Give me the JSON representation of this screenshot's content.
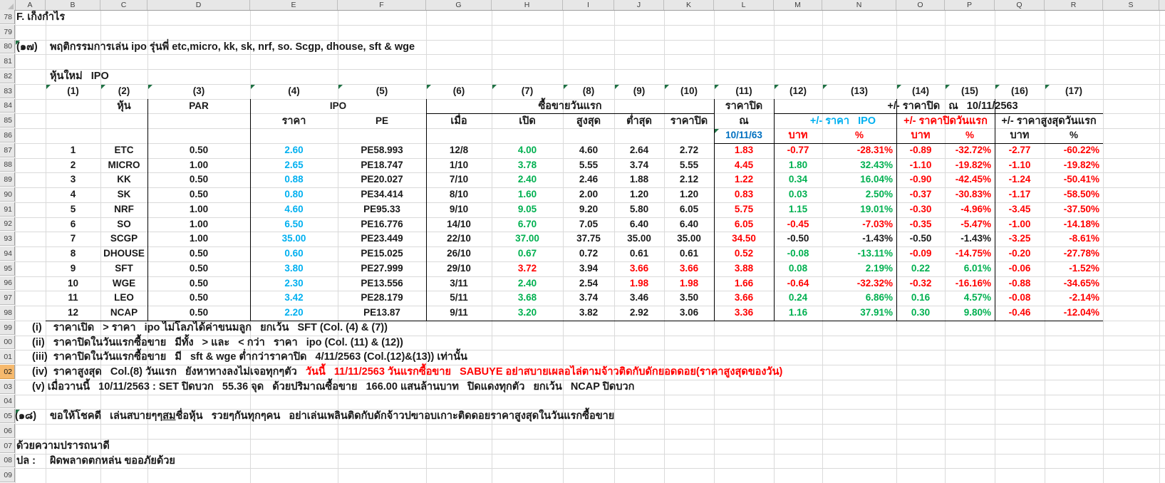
{
  "colors": {
    "black": "#1a1a1a",
    "red": "#FF0000",
    "green": "#00B050",
    "cyan": "#00B0F0",
    "navy": "#0070C0",
    "triangle_green": "#1f7244",
    "rowhead_highlight": "#f6b96d"
  },
  "sheet": {
    "column_letters": [
      "A",
      "B",
      "C",
      "D",
      "E",
      "F",
      "G",
      "H",
      "I",
      "J",
      "K",
      "L",
      "M",
      "N",
      "O",
      "P",
      "Q",
      "R",
      "S"
    ],
    "row_labels": [
      "78",
      "79",
      "80",
      "81",
      "82",
      "83",
      "84",
      "85",
      "86",
      "87",
      "88",
      "89",
      "90",
      "91",
      "92",
      "93",
      "94",
      "95",
      "96",
      "97",
      "98",
      "99",
      "00",
      "01",
      "02",
      "03",
      "04",
      "05",
      "06",
      "07",
      "08",
      "09"
    ],
    "highlighted_row_label": "02"
  },
  "texts": {
    "r78": "F. เก็งกำไร",
    "r80_no": "(๑๗)",
    "r80": "พฤติกรรมการเล่น ipo รุ่นพี่ etc,micro, kk, sk, nrf, so. Scgp, dhouse, sft & wge",
    "r82": "หุ้นใหม่   IPO",
    "r105_no": "(๑๘)",
    "r105_pre": "ขอให้โชคดี   เล่นสบายๆๆ",
    "r105_underline": "สม",
    "r105_post": "ชื่อหุ้น   รวยๆกันทุกๆคน   อย่าเล่นเพลินติดกับดักจ้าวปฃาอบเกาะติดดอยราคาสูงสุดในวันแรกซื้อขาย",
    "r107": "ด้วยความปรารถนาดี",
    "r108_no": "ปล :",
    "r108": "ผิดพลาดตกหล่น ขออภัยด้วย"
  },
  "notes": [
    {
      "black": "(i)    ราคาเปิด   > ราคา   ipo ไม่โลภได้ค่าขนมลูก   ยกเว้น   SFT (Col. (4) & (7))",
      "red": ""
    },
    {
      "black": "(ii)   ราคาปิดในวันแรกซื้อขาย   มีทั้ง   > และ   < กว่า   ราคา   ipo (Col. (11) & (12))",
      "red": ""
    },
    {
      "black": "(iii)  ราคาปิดในวันแรกซื้อขาย   มี   sft & wge ต่ำกว่าราคาปิด   4/11/2563 (Col.(12)&(13)) เท่านั้น",
      "red": ""
    },
    {
      "black": "(iv)  ราคาสูงสุด   Col.(8) วันแรก   ยังหาทางลงไม่เจอทุกๆตัว   ",
      "red": "วันนี้   11/11/2563 วันแรกซื้อขาย   SABUYE อย่าสบายเผลอไล่ตามจ้าวติดกับดักยอดดอย(ราคาสูงสุดของวัน)"
    },
    {
      "black": "(v) เมื่อวานนี้   10/11/2563 : SET ปิดบวก   55.36 จุด   ด้วยปริมาณซื้อขาย   166.00 แสนล้านบาท   ปิดแดงทุกตัว   ยกเว้น   NCAP ปิดบวก",
      "red": ""
    }
  ],
  "table": {
    "col_numbers": [
      "(1)",
      "(2)",
      "(3)",
      "(4)",
      "(5)",
      "(6)",
      "(7)",
      "(8)",
      "(9)",
      "(10)",
      "(11)",
      "(12)",
      "(13)",
      "(14)",
      "(15)",
      "(16)",
      "(17)"
    ],
    "group_headers": {
      "hun": "หุ้น",
      "par": "PAR",
      "ipo": "IPO",
      "first_day": "ซื้อขายวันแรก",
      "close_at": "ราคาปิด",
      "chg_close": "+/- ราคาปิด   ณ   10/11/2563"
    },
    "sub_headers": {
      "price": "ราคา",
      "pe": "PE",
      "when": "เมื่อ",
      "open": "เปิด",
      "high": "สูงสุด",
      "low": "ต่ำสุด",
      "close": "ราคาปิด",
      "at": "ณ",
      "date": "10/11/63",
      "chg_ipo": "+/- ราคา   IPO",
      "chg_day1": "+/- ราคาปิดวันแรก",
      "chg_high1": "+/- ราคาสูงสุดวันแรก",
      "baht": "บาท",
      "pct": "%"
    },
    "rows": [
      {
        "cells": [
          "1",
          "ETC",
          "0.50",
          "2.60",
          "PE58.993",
          "12/8",
          "4.00",
          "4.60",
          "2.64",
          "2.72",
          "1.83",
          "-0.77",
          "-28.31%",
          "-0.89",
          "-32.72%",
          "-2.77",
          "-60.22%"
        ],
        "colors": "kkkbkkgkkkrrrrrrr"
      },
      {
        "cells": [
          "2",
          "MICRO",
          "1.00",
          "2.65",
          "PE18.747",
          "1/10",
          "3.78",
          "5.55",
          "3.74",
          "5.55",
          "4.45",
          "1.80",
          "32.43%",
          "-1.10",
          "-19.82%",
          "-1.10",
          "-19.82%"
        ],
        "colors": "kkkbkkgkkkrggrrrr"
      },
      {
        "cells": [
          "3",
          "KK",
          "0.50",
          "0.88",
          "PE20.027",
          "7/10",
          "2.40",
          "2.46",
          "1.88",
          "2.12",
          "1.22",
          "0.34",
          "16.04%",
          "-0.90",
          "-42.45%",
          "-1.24",
          "-50.41%"
        ],
        "colors": "kkkbkkgkkkrggrrrr"
      },
      {
        "cells": [
          "4",
          "SK",
          "0.50",
          "0.80",
          "PE34.414",
          "8/10",
          "1.60",
          "2.00",
          "1.20",
          "1.20",
          "0.83",
          "0.03",
          "2.50%",
          "-0.37",
          "-30.83%",
          "-1.17",
          "-58.50%"
        ],
        "colors": "kkkbkkgkkkrggrrrr"
      },
      {
        "cells": [
          "5",
          "NRF",
          "1.00",
          "4.60",
          "PE95.33",
          "9/10",
          "9.05",
          "9.20",
          "5.80",
          "6.05",
          "5.75",
          "1.15",
          "19.01%",
          "-0.30",
          "-4.96%",
          "-3.45",
          "-37.50%"
        ],
        "colors": "kkkbkkgkkkrggrrrr"
      },
      {
        "cells": [
          "6",
          "SO",
          "1.00",
          "6.50",
          "PE16.776",
          "14/10",
          "6.70",
          "7.05",
          "6.40",
          "6.40",
          "6.05",
          "-0.45",
          "-7.03%",
          "-0.35",
          "-5.47%",
          "-1.00",
          "-14.18%"
        ],
        "colors": "kkkbkkgkkkrrrrrrr"
      },
      {
        "cells": [
          "7",
          "SCGP",
          "1.00",
          "35.00",
          "PE23.449",
          "22/10",
          "37.00",
          "37.75",
          "35.00",
          "35.00",
          "34.50",
          "-0.50",
          "-1.43%",
          "-0.50",
          "-1.43%",
          "-3.25",
          "-8.61%"
        ],
        "colors": "kkkbkkgkkkrkkkkrr"
      },
      {
        "cells": [
          "8",
          "DHOUSE",
          "0.50",
          "0.60",
          "PE15.025",
          "26/10",
          "0.67",
          "0.72",
          "0.61",
          "0.61",
          "0.52",
          "-0.08",
          "-13.11%",
          "-0.09",
          "-14.75%",
          "-0.20",
          "-27.78%"
        ],
        "colors": "kkkbkkgkkkrggrrrr"
      },
      {
        "cells": [
          "9",
          "SFT",
          "0.50",
          "3.80",
          "PE27.999",
          "29/10",
          "3.72",
          "3.94",
          "3.66",
          "3.66",
          "3.88",
          "0.08",
          "2.19%",
          "0.22",
          "6.01%",
          "-0.06",
          "-1.52%"
        ],
        "colors": "kkkbkkrkrrrggggrr"
      },
      {
        "cells": [
          "10",
          "WGE",
          "0.50",
          "2.30",
          "PE13.556",
          "3/11",
          "2.40",
          "2.54",
          "1.98",
          "1.98",
          "1.66",
          "-0.64",
          "-32.32%",
          "-0.32",
          "-16.16%",
          "-0.88",
          "-34.65%"
        ],
        "colors": "kkkbkkgkrrrrrrrrr"
      },
      {
        "cells": [
          "11",
          "LEO",
          "0.50",
          "3.42",
          "PE28.179",
          "5/11",
          "3.68",
          "3.74",
          "3.46",
          "3.50",
          "3.66",
          "0.24",
          "6.86%",
          "0.16",
          "4.57%",
          "-0.08",
          "-2.14%"
        ],
        "colors": "kkkbkkgkkkrggggrr"
      },
      {
        "cells": [
          "12",
          "NCAP",
          "0.50",
          "2.20",
          "PE13.87",
          "9/11",
          "3.20",
          "3.82",
          "2.92",
          "3.06",
          "3.36",
          "1.16",
          "37.91%",
          "0.30",
          "9.80%",
          "-0.46",
          "-12.04%"
        ],
        "colors": "kkkbkkgkkkrggggrr"
      }
    ]
  }
}
